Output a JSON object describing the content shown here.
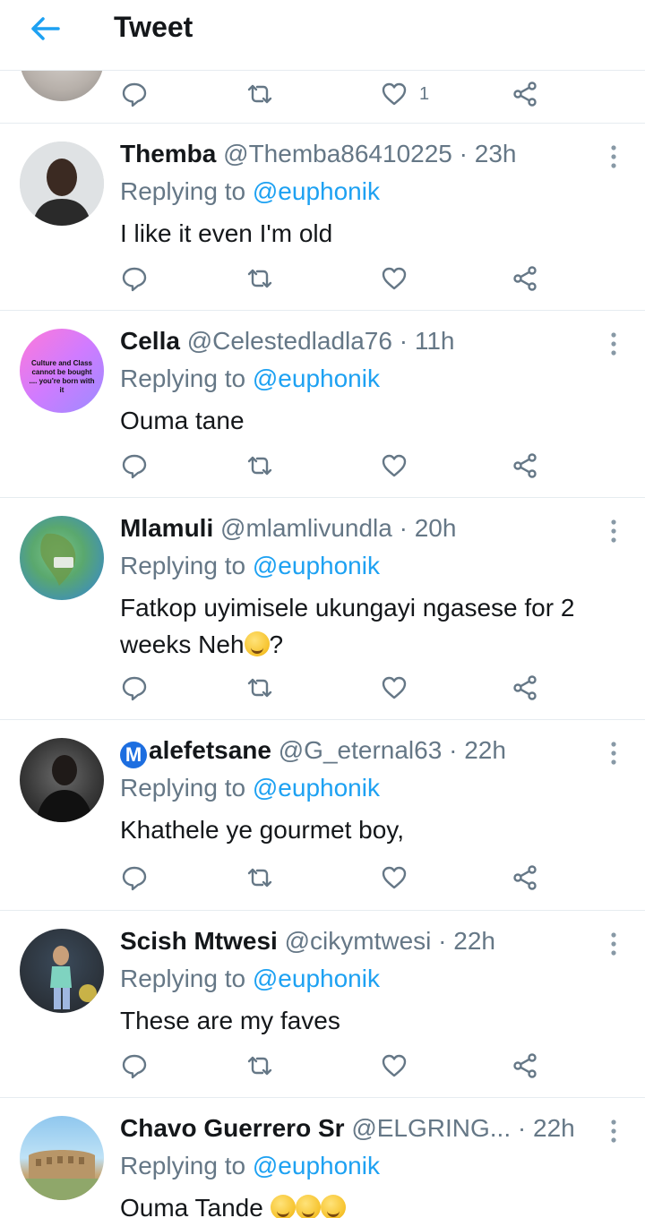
{
  "header": {
    "title": "Tweet"
  },
  "top_tweet": {
    "like_count": "1"
  },
  "tweets": [
    {
      "name": "Themba",
      "handle": "@Themba86410225",
      "time": "23h",
      "replying_prefix": "Replying to ",
      "replying_to": "@euphonik",
      "text": "I like it even I'm  old"
    },
    {
      "name": "Cella",
      "handle": "@Celestedladla76",
      "time": "11h",
      "replying_prefix": "Replying to ",
      "replying_to": "@euphonik",
      "text": "Ouma tane",
      "avatar_text": "Culture and Class cannot be bought .... you're born with it"
    },
    {
      "name": "Mlamuli",
      "handle": "@mlamlivundla",
      "time": "20h",
      "replying_prefix": "Replying to ",
      "replying_to": "@euphonik",
      "text": "Fatkop uyimisele ukungayi ngasese for 2 weeks Neh",
      "text_suffix": "?"
    },
    {
      "badge": "M",
      "name": "alefetsane",
      "handle": "@G_eternal63",
      "time": "22h",
      "replying_prefix": "Replying to ",
      "replying_to": "@euphonik",
      "text": "Khathele ye gourmet boy,"
    },
    {
      "name": "Scish Mtwesi",
      "handle": "@cikymtwesi",
      "time": "22h",
      "replying_prefix": "Replying to ",
      "replying_to": "@euphonik",
      "text": "These are my faves"
    },
    {
      "name": "Chavo Guerrero Sr",
      "handle": "@ELGRING...",
      "time": "22h",
      "replying_prefix": "Replying to ",
      "replying_to": "@euphonik",
      "text": "Ouma Tande"
    }
  ],
  "dot": "·",
  "colors": {
    "accent": "#1da1f2",
    "secondary_text": "#657786",
    "divider": "#e6ecf0"
  },
  "icons": [
    "back-arrow-icon",
    "reply-icon",
    "retweet-icon",
    "like-icon",
    "share-icon",
    "more-vertical-icon"
  ]
}
